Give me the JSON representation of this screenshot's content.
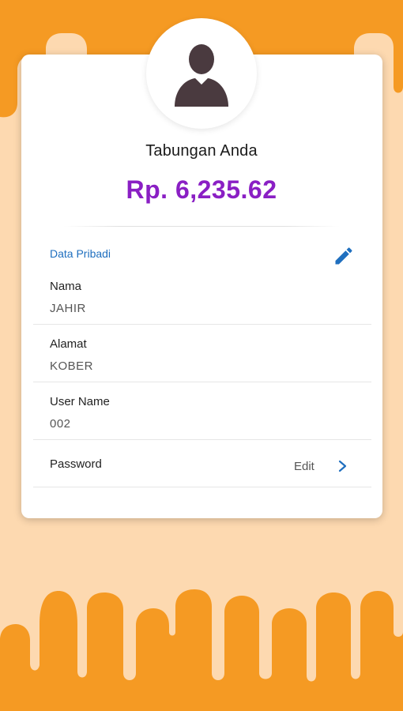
{
  "colors": {
    "background": "#FDD9B0",
    "accent_orange": "#F59A23",
    "balance_purple": "#8A1FC4",
    "link_blue": "#1F6FBF"
  },
  "profile": {
    "title": "Tabungan Anda",
    "balance": "Rp. 6,235.62",
    "avatar_icon": "user-avatar-icon"
  },
  "personal_data": {
    "section_label": "Data Pribadi",
    "edit_icon": "pencil-icon",
    "fields": [
      {
        "label": "Nama",
        "value": "JAHIR"
      },
      {
        "label": "Alamat",
        "value": "KOBER"
      },
      {
        "label": "User Name",
        "value": "002"
      }
    ]
  },
  "password": {
    "label": "Password",
    "action_label": "Edit",
    "chevron_icon": "chevron-right-icon"
  }
}
